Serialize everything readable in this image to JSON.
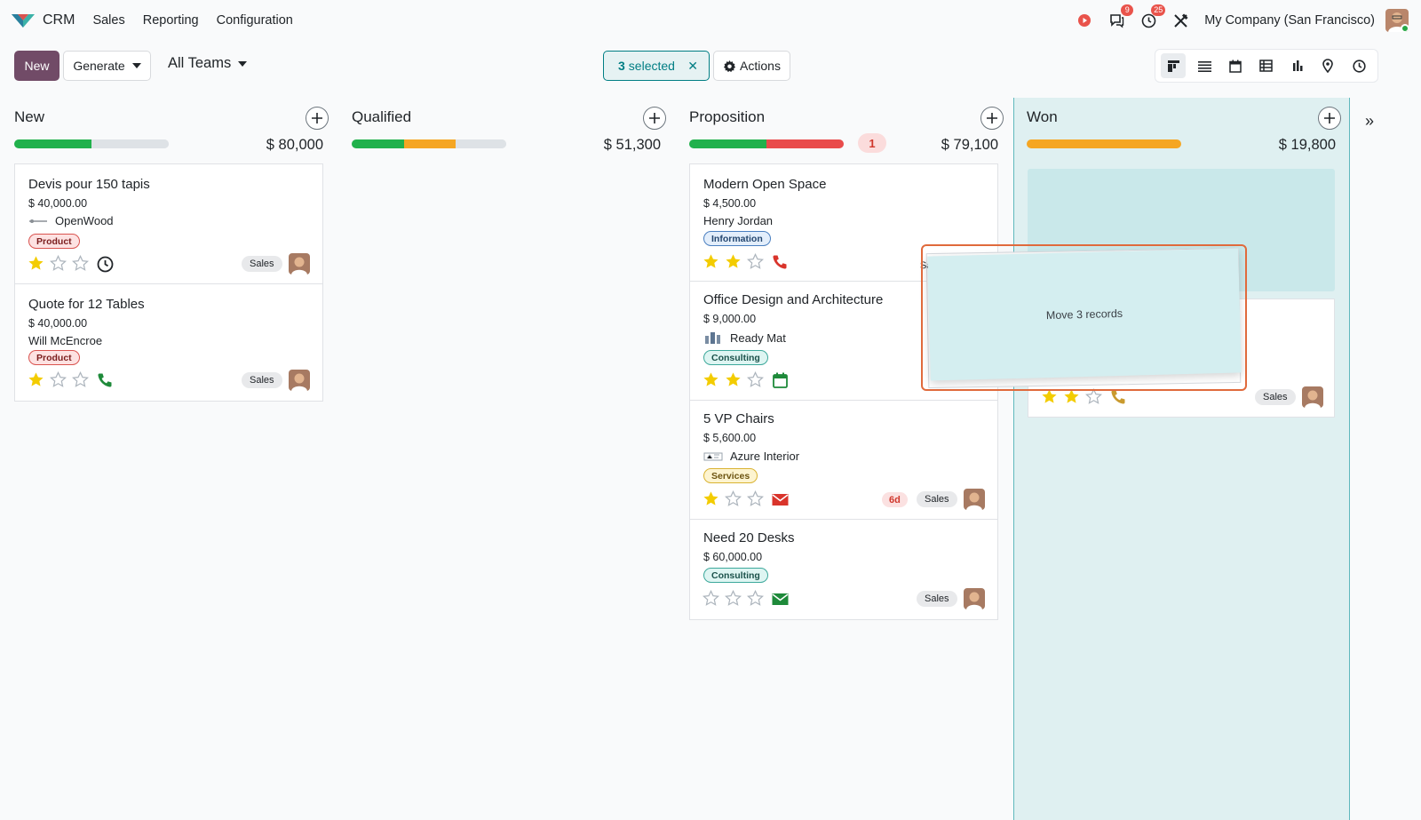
{
  "navbar": {
    "app_name": "CRM",
    "menu": [
      "Sales",
      "Reporting",
      "Configuration"
    ],
    "messages_badge": "9",
    "activities_badge": "25",
    "company": "My Company (San Francisco)"
  },
  "control": {
    "new_label": "New",
    "generate_label": "Generate",
    "teams_label": "All Teams",
    "selected_count": "3",
    "selected_label": "selected",
    "actions_label": "Actions"
  },
  "columns": [
    {
      "title": "New",
      "total": "$ 80,000",
      "bar": [
        {
          "kind": "green",
          "fraction": 0.5
        },
        {
          "kind": "grey",
          "fraction": 0.5
        }
      ],
      "cards": [
        {
          "title": "Devis pour 150 tapis",
          "amount": "$ 40,000.00",
          "partner": "OpenWood",
          "tag": "Product",
          "stars": 1,
          "activity": "clock",
          "team": "Sales"
        },
        {
          "title": "Quote for 12 Tables",
          "amount": "$ 40,000.00",
          "partner": "Will McEncroe",
          "tag": "Product",
          "stars": 1,
          "activity": "phone-green",
          "team": "Sales"
        }
      ]
    },
    {
      "title": "Qualified",
      "total": "$ 51,300",
      "bar": [
        {
          "kind": "green",
          "fraction": 0.34
        },
        {
          "kind": "orange",
          "fraction": 0.33
        },
        {
          "kind": "grey",
          "fraction": 0.33
        }
      ],
      "cards": []
    },
    {
      "title": "Proposition",
      "total": "$ 79,100",
      "count_badge": "1",
      "bar": [
        {
          "kind": "green",
          "fraction": 0.5
        },
        {
          "kind": "red",
          "fraction": 0.5
        }
      ],
      "cards": [
        {
          "title": "Modern Open Space",
          "amount": "$ 4,500.00",
          "partner": "Henry Jordan",
          "tag": "Information",
          "stars": 2,
          "activity": "phone-red",
          "team": "Sales"
        },
        {
          "title": "Office Design and Architecture",
          "amount": "$ 9,000.00",
          "partner": "Ready Mat",
          "tag": "Consulting",
          "stars": 2,
          "activity": "calendar-green",
          "team": "Sales"
        },
        {
          "title": "5 VP Chairs",
          "amount": "$ 5,600.00",
          "partner": "Azure Interior",
          "tag": "Services",
          "stars": 1,
          "activity": "mail-red",
          "days": "6d",
          "team": "Sales"
        },
        {
          "title": "Need 20 Desks",
          "amount": "$ 60,000.00",
          "partner": "",
          "tag": "Consulting",
          "stars": 0,
          "activity": "mail-green",
          "team": "Sales"
        }
      ]
    },
    {
      "title": "Won",
      "total": "$ 19,800",
      "bar": [
        {
          "kind": "orange",
          "fraction": 1.0
        }
      ],
      "cards": [
        {
          "team": "Sales",
          "stars": 2
        }
      ]
    }
  ],
  "drag": {
    "label": "Move 3 records",
    "team_peek": "Sales"
  },
  "colors": {
    "brand": "#714b67",
    "accent": "#017e84",
    "green": "#21b14c",
    "orange": "#f5a623",
    "red": "#e94b4b",
    "star": "#f3cc00"
  }
}
